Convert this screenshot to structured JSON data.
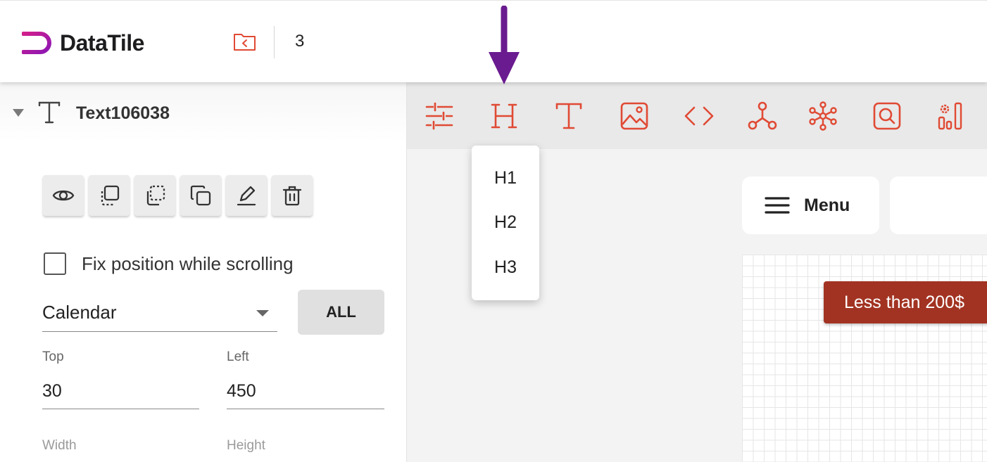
{
  "header": {
    "logo_text": "DataTile",
    "folder_icon": "folder-back-icon",
    "count": "3"
  },
  "panel": {
    "element_type_icon": "text-type-icon",
    "element_name": "Text106038",
    "actions": [
      {
        "icon": "eye-icon"
      },
      {
        "icon": "bring-front-icon"
      },
      {
        "icon": "send-back-icon"
      },
      {
        "icon": "duplicate-icon"
      },
      {
        "icon": "edit-icon"
      },
      {
        "icon": "trash-icon"
      }
    ],
    "fix_position_label": "Fix position while scrolling",
    "fix_position_checked": false,
    "select_value": "Calendar",
    "all_button": "ALL",
    "top_label": "Top",
    "top_value": "30",
    "left_label": "Left",
    "left_value": "450",
    "width_label": "Width",
    "height_label": "Height"
  },
  "toolbar": {
    "tools": [
      "sliders-icon",
      "heading-icon",
      "text-icon",
      "image-icon",
      "code-icon",
      "graph-icon",
      "network-icon",
      "search-icon",
      "settings-bars-icon"
    ]
  },
  "heading_menu": {
    "items": [
      "H1",
      "H2",
      "H3"
    ]
  },
  "canvas": {
    "menu_label": "Menu",
    "price_tag": "Less than 200$"
  },
  "colors": {
    "accent": "#e04a34",
    "brand": "#b0169a",
    "price_tag": "#a23322",
    "annotation_arrow": "#6a1b8f"
  }
}
